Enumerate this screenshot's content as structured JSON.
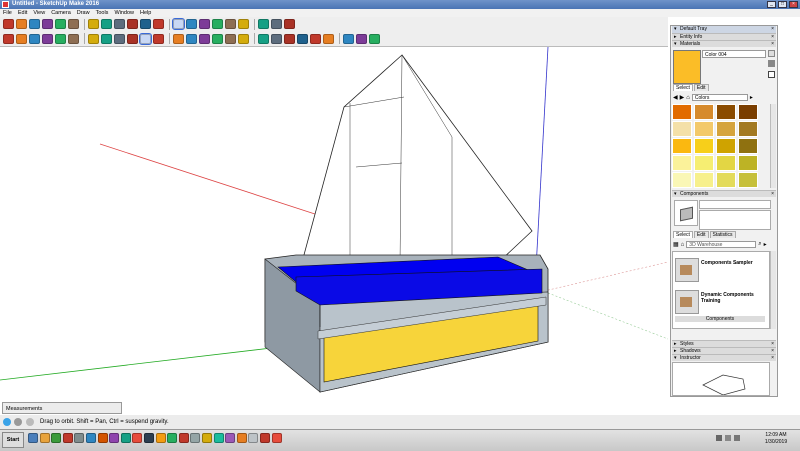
{
  "window": {
    "title": "Untitled - SketchUp Make 2016",
    "buttons": [
      "_",
      "□",
      "×"
    ]
  },
  "menu": [
    "File",
    "Edit",
    "View",
    "Camera",
    "Draw",
    "Tools",
    "Window",
    "Help"
  ],
  "toolbar1": [
    "select",
    "eraser",
    "paint",
    "pencil",
    "arc",
    "rectangle",
    "push-pull",
    "move",
    "rotate",
    "offset",
    "tape",
    "text",
    "orbit",
    "pan",
    "zoom",
    "zoom-extents",
    "3d-warehouse",
    "extension-warehouse",
    "layout",
    "styles",
    "footprints"
  ],
  "toolbar2": [
    "select-arrow",
    "eraser",
    "pencil",
    "arc",
    "shapes",
    "push-pull",
    "move",
    "rotate",
    "scale",
    "offset",
    "orbit",
    "pan",
    "zoom",
    "zoom-window",
    "zoom-extents",
    "previous",
    "sections",
    "styles",
    "camera",
    "position-camera",
    "walk",
    "look-around",
    "dims",
    "text",
    "axes",
    "3d-text",
    "paint"
  ],
  "tray": {
    "title": "Default Tray",
    "entity_info": "Entity Info",
    "materials": {
      "title": "Materials",
      "color_name": "Color 004",
      "tabs": [
        "Select",
        "Edit"
      ],
      "library": "Colors",
      "swatches": [
        "#e26b00",
        "#d68a2c",
        "#8a4b00",
        "#7a3e00",
        "#f4e0a8",
        "#f3c96a",
        "#d5a43e",
        "#a37a22",
        "#fbb810",
        "#f7cf1a",
        "#cfa300",
        "#8f7110",
        "#fbf29a",
        "#f6ee72",
        "#e3d644",
        "#bdb325",
        "#faf7b6",
        "#f7f08c",
        "#e3db5a",
        "#c6c03a"
      ],
      "current": "#fbbd27"
    },
    "components": {
      "title": "Components",
      "tabs": [
        "Select",
        "Edit",
        "Statistics"
      ],
      "search": "3D Warehouse",
      "items": [
        "Components Sampler",
        "Dynamic Components Training"
      ],
      "footer": "Components"
    },
    "collapsed": [
      "Styles",
      "Shadows",
      "Instructor"
    ]
  },
  "measurements": {
    "label": "Measurements"
  },
  "status": {
    "text": "Drag to orbit. Shift = Pan, Ctrl = suspend gravity."
  },
  "taskbar": {
    "start": "Start",
    "time": "12:09 AM",
    "date": "1/30/2019"
  }
}
